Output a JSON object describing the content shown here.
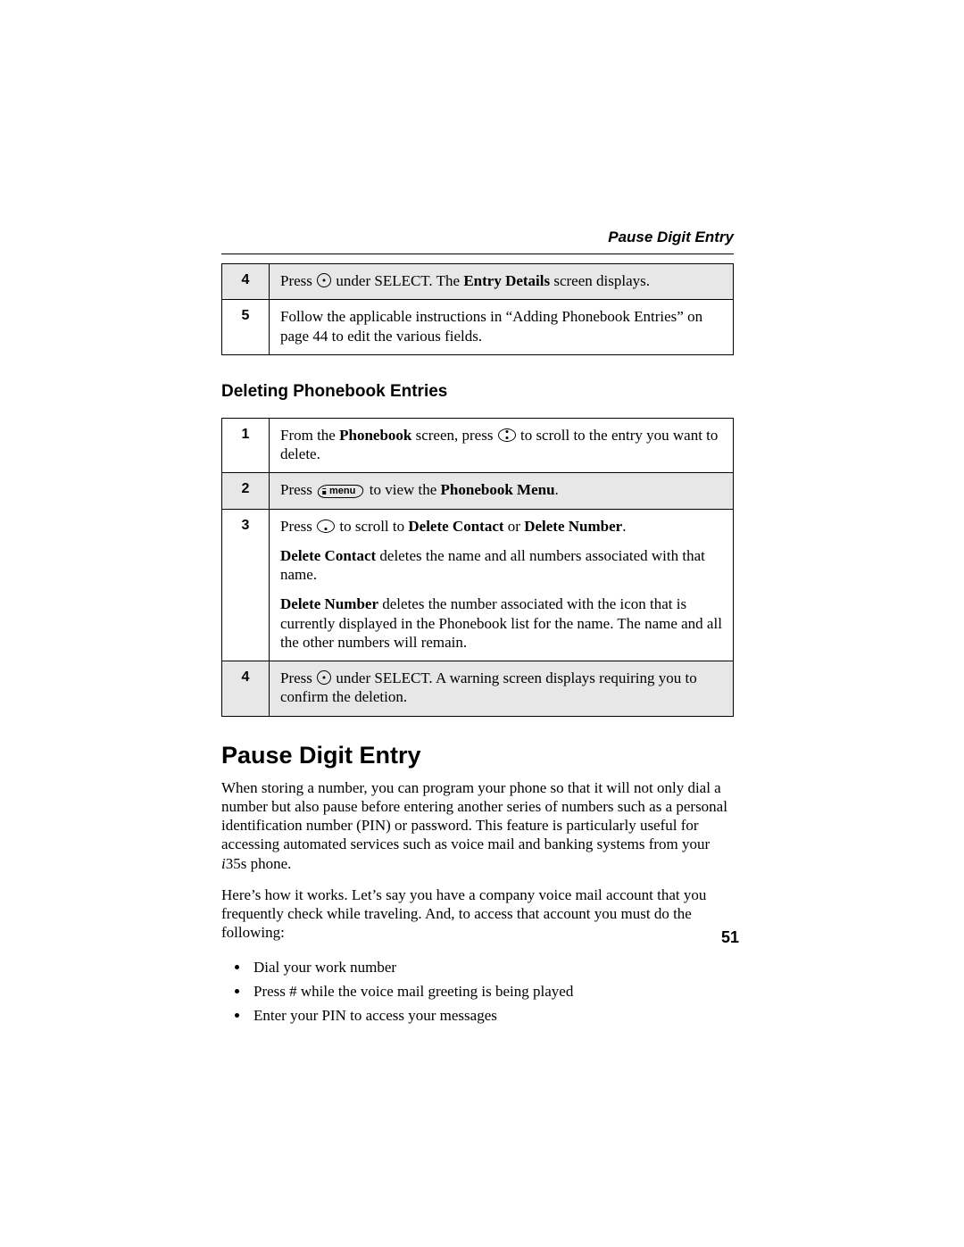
{
  "header": {
    "running_head": "Pause Digit Entry"
  },
  "table1": {
    "rows": [
      {
        "num": "4",
        "pre": "Press ",
        "mid": " under SELECT. The ",
        "bold1": "Entry Details",
        "post": " screen displays."
      },
      {
        "num": "5",
        "text": "Follow the applicable instructions in “Adding Phonebook Entries” on page 44 to edit the various fields."
      }
    ]
  },
  "section_delete": {
    "heading": "Deleting Phonebook Entries",
    "rows": [
      {
        "num": "1",
        "pre": "From the ",
        "b1": "Phonebook",
        "mid": " screen, press ",
        "post": " to scroll to the entry you want to delete."
      },
      {
        "num": "2",
        "pre": "Press ",
        "mid": " to view the ",
        "b1": "Phonebook Menu",
        "post": "."
      },
      {
        "num": "3",
        "l1_pre": "Press ",
        "l1_mid": " to scroll to ",
        "l1_b1": "Delete Contact",
        "l1_or": " or ",
        "l1_b2": "Delete Number",
        "l1_post": ".",
        "l2_b": "Delete Contact",
        "l2_rest": " deletes the name and all numbers associated with that name.",
        "l3_b": "Delete Number",
        "l3_rest": " deletes the number associated with the icon that is currently displayed in the Phonebook list for the name. The name and all the other numbers will remain."
      },
      {
        "num": "4",
        "pre": "Press ",
        "post": " under SELECT. A warning screen displays requiring you to confirm the deletion."
      }
    ]
  },
  "section_pause": {
    "heading": "Pause Digit Entry",
    "para1_pre": "When storing a number, you can program your phone so that it will not only dial a number but also pause before entering another series of numbers such as a personal identification number (PIN) or password. This feature is particularly useful for accessing automated services such as voice mail and banking systems from your ",
    "model_italic": "i",
    "model_rest": "35s",
    "para1_post": " phone.",
    "para2": "Here’s how it works. Let’s say you have a company voice mail account that you frequently check while traveling. And, to access that account you must do the following:",
    "bullets": [
      "Dial your work number",
      "Press # while the voice mail greeting is being played",
      "Enter your PIN to access your messages"
    ]
  },
  "page_number": "51",
  "icons": {
    "menu_label": "menu"
  }
}
